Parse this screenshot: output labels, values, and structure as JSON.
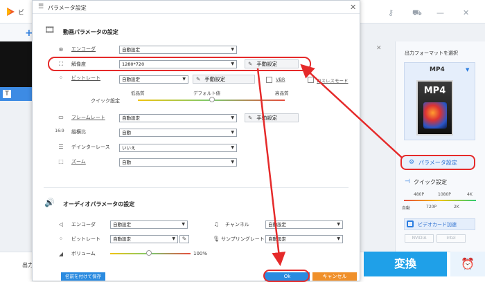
{
  "app": {
    "title": "ビ",
    "output_label": "出力",
    "format_panel": {
      "title": "出力フォーマットを選択",
      "format_name": "MP4",
      "icon_text": "MP4",
      "param_button": "パラメータ設定",
      "quick_label": "クイック設定",
      "quick_top_ticks": [
        "480P",
        "1080P",
        "4K"
      ],
      "quick_bottom_ticks": [
        "自動",
        "720P",
        "2K"
      ],
      "gpu_label": "ビデオカード加速",
      "gpu_chips": [
        "NVIDIA",
        "Intel"
      ]
    },
    "convert_label": "変換",
    "alarm_icon": "alarm-clock-icon"
  },
  "dialog": {
    "title": "パラメータ設定",
    "video_section": {
      "title": "動画パラメータの設定",
      "encoder": {
        "label": "エンコーダ",
        "value": "自動設定"
      },
      "resolution": {
        "label": "解像度",
        "value": "1280*720",
        "manual": "手動設定"
      },
      "bitrate": {
        "label": "ビットレート",
        "value": "自動設定",
        "manual": "手動設定",
        "vbr_label": "VBR",
        "lossless_label": "ロスレスモード"
      },
      "quick": {
        "label": "クイック設定",
        "low": "低品質",
        "default": "デフォルト値",
        "high": "高品質"
      },
      "framerate": {
        "label": "フレームレート",
        "value": "自動設定",
        "manual": "手動設定"
      },
      "aspect": {
        "label": "縦横比",
        "value": "自動"
      },
      "deinterlace": {
        "label": "デインターレース",
        "value": "いいえ"
      },
      "zoom": {
        "label": "ズーム",
        "value": "自動"
      }
    },
    "audio_section": {
      "title": "オーディオパラメータの設定",
      "encoder": {
        "label": "エンコーダ",
        "value": "自動設定"
      },
      "channel": {
        "label": "チャンネル",
        "value": "自動設定"
      },
      "bitrate": {
        "label": "ビットレート",
        "value": "自動設定"
      },
      "samplerate": {
        "label": "サンプリングレート",
        "value": "自動設定"
      },
      "volume": {
        "label": "ボリューム",
        "value": "100%"
      }
    },
    "buttons": {
      "save_as": "名前を付けて保存",
      "ok": "Ok",
      "cancel": "キャンセル"
    }
  },
  "colors": {
    "accent": "#2b8be0",
    "highlight": "#e52a2a",
    "cancel": "#f0902a",
    "convert": "#1fa0e8"
  }
}
